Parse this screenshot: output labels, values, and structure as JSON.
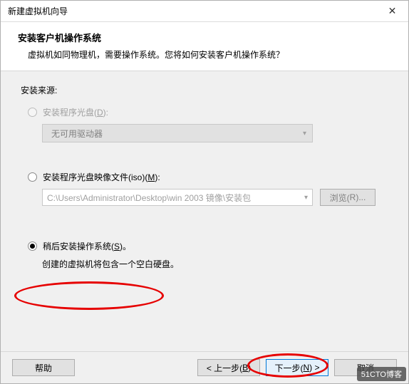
{
  "titlebar": {
    "title": "新建虚拟机向导",
    "close_label": "✕"
  },
  "header": {
    "title": "安装客户机操作系统",
    "desc": "虚拟机如同物理机，需要操作系统。您将如何安装客户机操作系统？"
  },
  "content": {
    "source_label": "安装来源:",
    "option_disc": {
      "label_pre": "安装程序光盘(",
      "hotkey": "D",
      "label_post": "):"
    },
    "disc_combo": {
      "text": "无可用驱动器"
    },
    "option_iso": {
      "label_pre": "安装程序光盘映像文件(iso)(",
      "hotkey": "M",
      "label_post": "):"
    },
    "iso_path": "C:\\Users\\Administrator\\Desktop\\win 2003 镜像\\安装包",
    "browse": {
      "label_pre": "浏览(",
      "hotkey": "R",
      "label_post": ")..."
    },
    "option_later": {
      "label_pre": "稍后安装操作系统(",
      "hotkey": "S",
      "label_post": ")。"
    },
    "later_desc": "创建的虚拟机将包含一个空白硬盘。"
  },
  "footer": {
    "help": "帮助",
    "back_pre": "< 上一步(",
    "back_hotkey": "B",
    "back_post": ")",
    "next_pre": "下一步(",
    "next_hotkey": "N",
    "next_post": ") >",
    "cancel": "取消"
  },
  "watermark": "51CTO博客"
}
